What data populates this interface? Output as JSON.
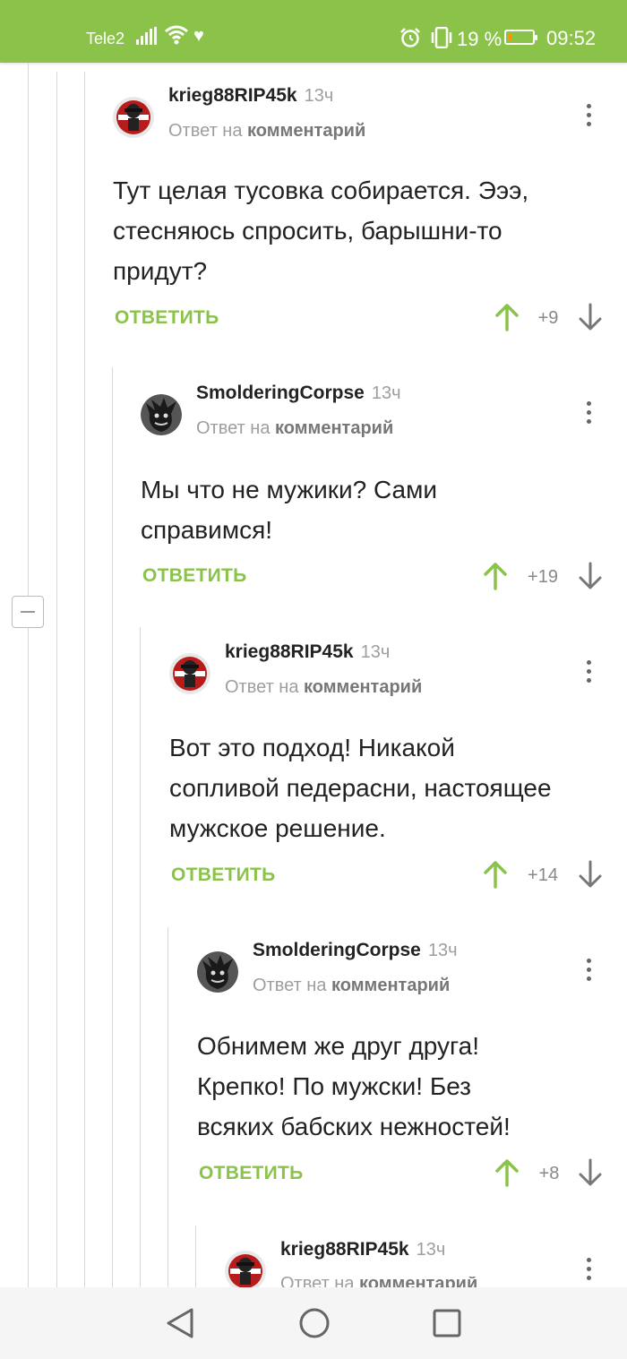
{
  "status_bar": {
    "carrier": "Tele2",
    "battery_percent": "19 %",
    "battery_level": 0.19,
    "time": "09:52"
  },
  "colors": {
    "accent": "#8bc34a",
    "muted": "#9e9e9e",
    "text": "#222222"
  },
  "comments": [
    {
      "author": "krieg88RIP45k",
      "time": "13ч",
      "reply_prefix": "Ответ на",
      "reply_link": "комментарий",
      "lines": [
        "Тут целая тусовка собирается. Эээ,",
        "стесняюсь спросить, барышни-то",
        "придут?"
      ],
      "reply_label": "ОТВЕТИТЬ",
      "score": "+9",
      "avatar_icon": "soldier-avatar-icon"
    },
    {
      "author": "SmolderingCorpse",
      "time": "13ч",
      "reply_prefix": "Ответ на",
      "reply_link": "комментарий",
      "lines": [
        "Мы что не мужики? Сами",
        "справимся!"
      ],
      "reply_label": "ОТВЕТИТЬ",
      "score": "+19",
      "avatar_icon": "dark-character-avatar-icon"
    },
    {
      "author": "krieg88RIP45k",
      "time": "13ч",
      "reply_prefix": "Ответ на",
      "reply_link": "комментарий",
      "lines": [
        "Вот это подход! Никакой",
        "сопливой педерасни, настоящее",
        "мужское решение."
      ],
      "reply_label": "ОТВЕТИТЬ",
      "score": "+14",
      "avatar_icon": "soldier-avatar-icon"
    },
    {
      "author": "SmolderingCorpse",
      "time": "13ч",
      "reply_prefix": "Ответ на",
      "reply_link": "комментарий",
      "lines": [
        "Обнимем же друг друга!",
        "Крепко! По мужски! Без",
        "всяких бабских нежностей!"
      ],
      "reply_label": "ОТВЕТИТЬ",
      "score": "+8",
      "avatar_icon": "dark-character-avatar-icon"
    },
    {
      "author": "krieg88RIP45k",
      "time": "13ч",
      "reply_prefix": "Ответ на",
      "reply_link": "комментарий",
      "avatar_icon": "soldier-avatar-icon"
    }
  ],
  "nav_bar": {
    "back_icon": "back-triangle-icon",
    "home_icon": "home-circle-icon",
    "recents_icon": "recents-square-icon"
  }
}
